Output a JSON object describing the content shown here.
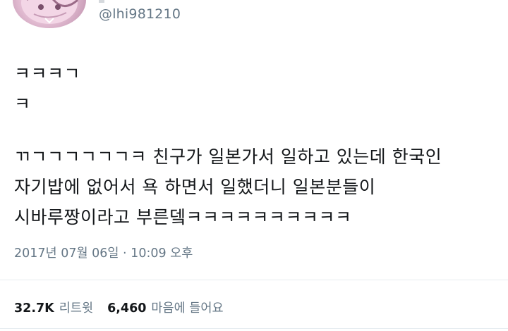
{
  "author": {
    "handle": "@lhi981210"
  },
  "tweet": {
    "lines_a": [
      "ㅋㅋㅋㄱ",
      "ㅋ"
    ],
    "lines_b": [
      "ㄲㄱㄱㄱㄱㄱㄱㅋ 친구가 일본가서 일하고 있는데 한국인",
      "자기밥에 없어서 욕 하면서 일했더니 일본분들이",
      "시바루짱이라고 부른뎈ㅋㅋㅋㅋㅋㅋㅋㅋㅋㅋ"
    ],
    "timestamp": "2017년 07월 06일 · 10:09 오후"
  },
  "stats": {
    "retweets_count": "32.7K",
    "retweets_label": "리트윗",
    "likes_count": "6,460",
    "likes_label": "마음에 들어요"
  }
}
